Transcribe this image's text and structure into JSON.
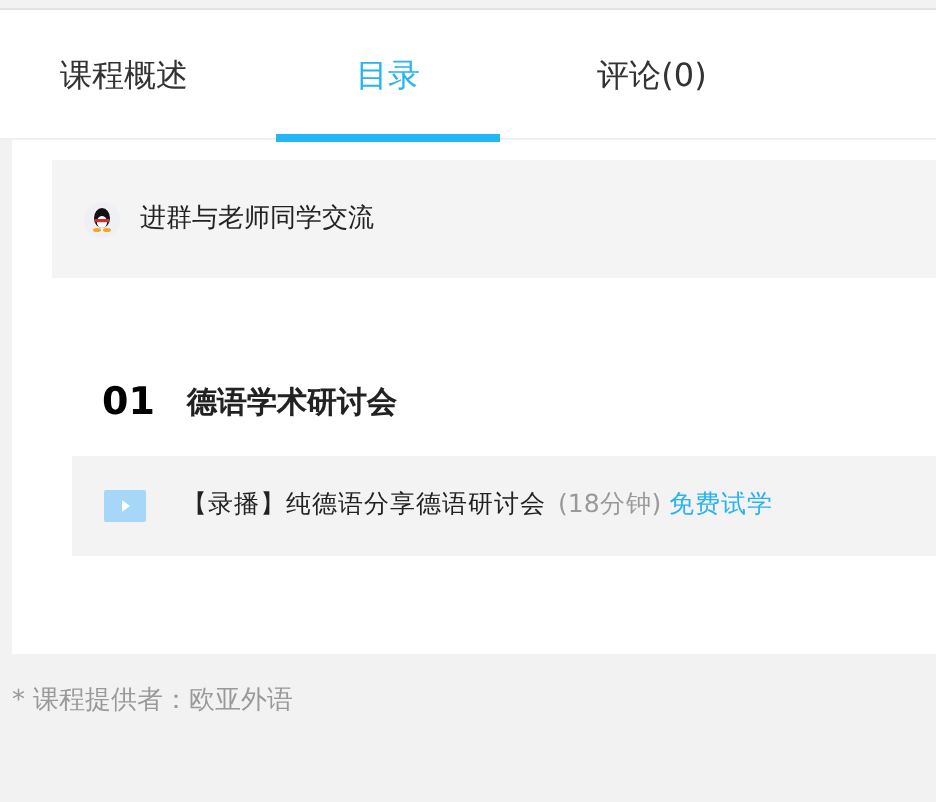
{
  "tabs": [
    {
      "label": "课程概述",
      "selected": false
    },
    {
      "label": "目录",
      "selected": true
    },
    {
      "label": "评论(0)",
      "selected": false
    }
  ],
  "group_link": {
    "text": "进群与老师同学交流"
  },
  "chapters": [
    {
      "number": "01",
      "title": "德语学术研讨会",
      "lessons": [
        {
          "title": "【录播】纯德语分享德语研讨会",
          "duration": "(18分钟)",
          "trial": "免费试学"
        }
      ]
    }
  ],
  "footer": "* 课程提供者：欧亚外语"
}
